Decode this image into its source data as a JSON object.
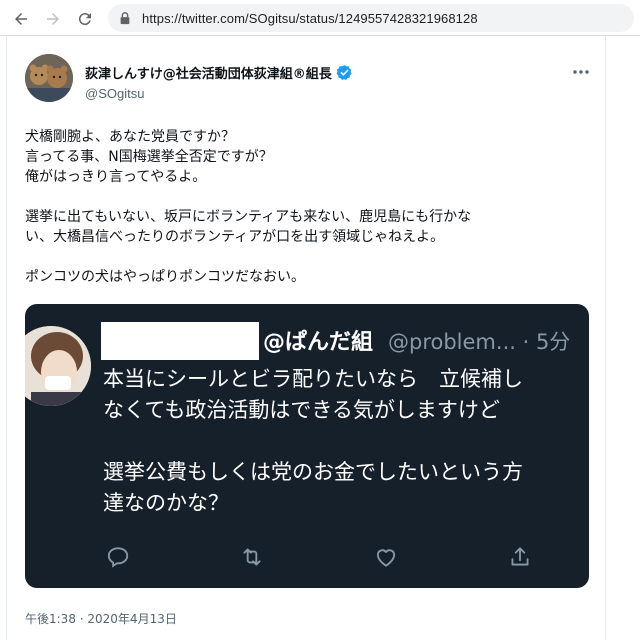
{
  "browser": {
    "url": "https://twitter.com/SOgitsu/status/1249557428321968128",
    "icons": [
      "back-arrow-icon",
      "forward-arrow-icon",
      "reload-icon",
      "lock-icon"
    ]
  },
  "tweet": {
    "display_name": "荻津しんすけ@社会活動団体荻津組®組長",
    "handle": "@SOgitsu",
    "verified": true,
    "lines": [
      "犬橋剛腕よ、あなた党員ですか？",
      "言ってる事、N国梅選挙全否定ですが？",
      "俺がはっきり言ってやるよ。",
      "",
      "選挙に出てもいない、坂戸にボランティアも来ない、鹿児島にも行かな",
      "い、大橋昌信べったりのボランティアが口を出す領域じゃねえよ。",
      "",
      "ポンコツの犬はやっぱりポンコツだなおい。"
    ],
    "timestamp": "午後1:38 · 2020年4月13日",
    "more_icon": "more-dots-icon"
  },
  "quoted": {
    "name": "@ぱんだ組",
    "handle": "@problem... · 5分",
    "lines": [
      "本当にシールとビラ配りたいなら　立候補し",
      "なくても政治活動はできる気がしますけど",
      "",
      "選挙公費もしくは党のお金でしたいという方",
      "達なのかな？"
    ],
    "actions": [
      "reply-icon",
      "retweet-icon",
      "like-icon",
      "share-icon"
    ],
    "bg_color": "#15202b"
  },
  "colors": {
    "verified": "#1d9bf0",
    "secondary_text": "#536471",
    "quoted_secondary": "#8899a6"
  }
}
